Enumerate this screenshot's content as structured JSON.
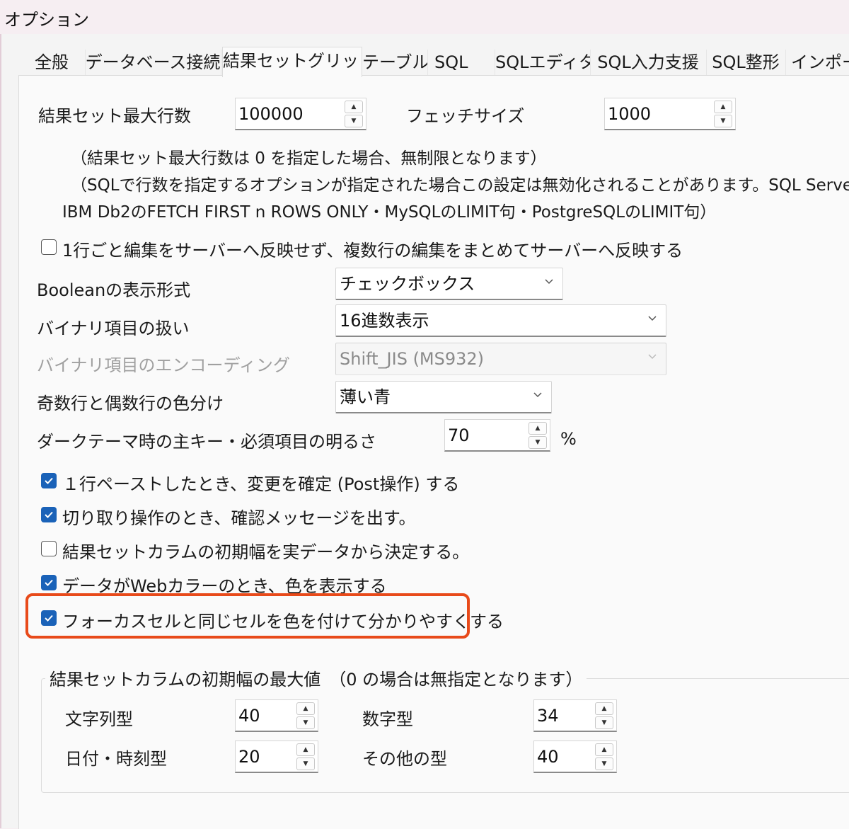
{
  "window": {
    "title": "オプション"
  },
  "tabs": [
    {
      "label": "全般"
    },
    {
      "label": "データベース接続"
    },
    {
      "label": "結果セットグリッド"
    },
    {
      "label": "テーブル"
    },
    {
      "label": "SQL"
    },
    {
      "label": "SQLエディタ"
    },
    {
      "label": "SQL入力支援"
    },
    {
      "label": "SQL整形"
    },
    {
      "label": "インポー"
    }
  ],
  "active_tab": "結果セットグリッド",
  "grid": {
    "max_rows_label": "結果セット最大行数",
    "max_rows_value": "100000",
    "fetch_size_label": "フェッチサイズ",
    "fetch_size_value": "1000",
    "note1": "（結果セット最大行数は 0 を指定した場合、無制限となります）",
    "note2": "（SQLで行数を指定するオプションが指定された場合この設定は無効化されることがあります。SQL Serverの",
    "note3": "IBM Db2のFETCH FIRST n ROWS ONLY・MySQLのLIMIT句・PostgreSQLのLIMIT句）",
    "batch_edit_label": "1行ごと編集をサーバーへ反映せず、複数行の編集をまとめてサーバーへ反映する",
    "batch_edit_checked": false,
    "boolean_label": "Booleanの表示形式",
    "boolean_value": "チェックボックス",
    "binary_label": "バイナリ項目の扱い",
    "binary_value": "16進数表示",
    "encoding_label": "バイナリ項目のエンコーディング",
    "encoding_value": "Shift_JIS (MS932)",
    "row_color_label": "奇数行と偶数行の色分け",
    "row_color_value": "薄い青",
    "brightness_label": "ダークテーマ時の主キー・必須項目の明るさ",
    "brightness_value": "70",
    "brightness_unit": "%",
    "checkboxes": [
      {
        "label": "１行ペーストしたとき、変更を確定 (Post操作) する",
        "checked": true
      },
      {
        "label": "切り取り操作のとき、確認メッセージを出す。",
        "checked": true
      },
      {
        "label": "結果セットカラムの初期幅を実データから決定する。",
        "checked": false
      },
      {
        "label": "データがWebカラーのとき、色を表示する",
        "checked": true
      },
      {
        "label": "フォーカスセルと同じセルを色を付けて分かりやすくする",
        "checked": true
      }
    ]
  },
  "width_group": {
    "title": "結果セットカラムの初期幅の最大値　（0 の場合は無指定となります）",
    "string_label": "文字列型",
    "string_value": "40",
    "number_label": "数字型",
    "number_value": "34",
    "datetime_label": "日付・時刻型",
    "datetime_value": "20",
    "other_label": "その他の型",
    "other_value": "40"
  },
  "colors": {
    "accent": "#1a62b8",
    "highlight_border": "#e84a1a"
  }
}
